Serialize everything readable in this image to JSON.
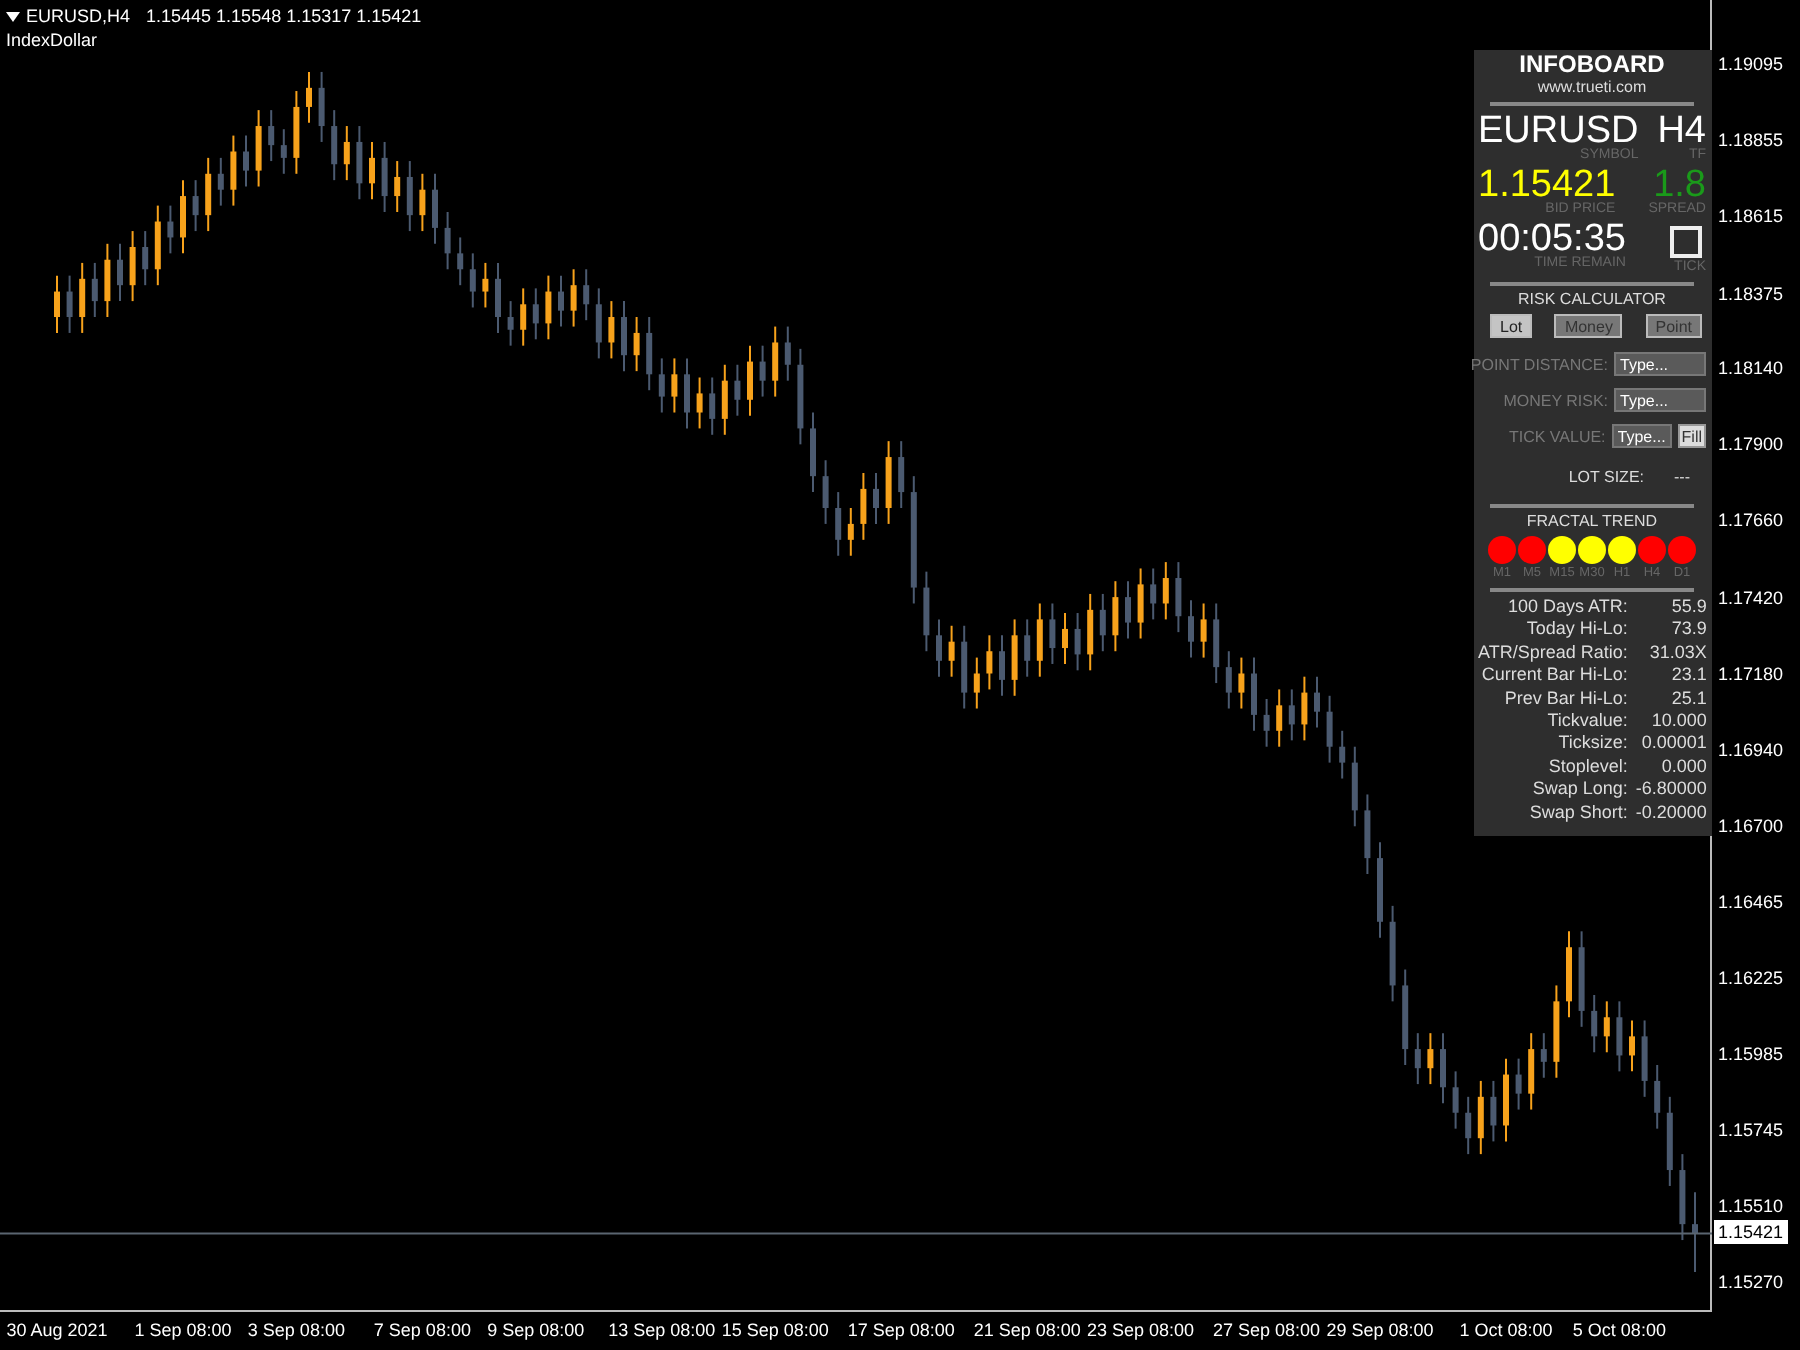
{
  "chart_header": {
    "symbol": "EURUSD,H4",
    "ohlc": "1.15445 1.15548 1.15317 1.15421",
    "indicator": "IndexDollar"
  },
  "chart_data": {
    "type": "candlestick",
    "ylim": [
      1.15174,
      1.19296
    ],
    "ref_lines": [
      {
        "axis": "y",
        "value": 1.15421,
        "label": "1.15421"
      }
    ],
    "yticks": [
      {
        "value": 1.19095,
        "label": "1.19095"
      },
      {
        "value": 1.18855,
        "label": "1.18855"
      },
      {
        "value": 1.18615,
        "label": "1.18615"
      },
      {
        "value": 1.18375,
        "label": "1.18375"
      },
      {
        "value": 1.1814,
        "label": "1.18140"
      },
      {
        "value": 1.179,
        "label": "1.17900"
      },
      {
        "value": 1.1766,
        "label": "1.17660"
      },
      {
        "value": 1.1742,
        "label": "1.17420"
      },
      {
        "value": 1.1718,
        "label": "1.17180"
      },
      {
        "value": 1.1694,
        "label": "1.16940"
      },
      {
        "value": 1.167,
        "label": "1.16700"
      },
      {
        "value": 1.16465,
        "label": "1.16465"
      },
      {
        "value": 1.16225,
        "label": "1.16225"
      },
      {
        "value": 1.15985,
        "label": "1.15985"
      },
      {
        "value": 1.15745,
        "label": "1.15745"
      },
      {
        "value": 1.1551,
        "label": "1.15510"
      },
      {
        "value": 1.1527,
        "label": "1.15270"
      }
    ],
    "categories": [
      "30 Aug 2021",
      null,
      null,
      null,
      null,
      null,
      null,
      null,
      null,
      null,
      "1 Sep 08:00",
      null,
      null,
      null,
      null,
      null,
      null,
      null,
      null,
      "3 Sep 08:00",
      null,
      null,
      null,
      null,
      null,
      null,
      null,
      null,
      null,
      "7 Sep 08:00",
      null,
      null,
      null,
      null,
      null,
      null,
      null,
      null,
      "9 Sep 08:00",
      null,
      null,
      null,
      null,
      null,
      null,
      null,
      null,
      null,
      "13 Sep 08:00",
      null,
      null,
      null,
      null,
      null,
      null,
      null,
      null,
      "15 Sep 08:00",
      null,
      null,
      null,
      null,
      null,
      null,
      null,
      null,
      null,
      "17 Sep 08:00",
      null,
      null,
      null,
      null,
      null,
      null,
      null,
      null,
      null,
      "21 Sep 08:00",
      null,
      null,
      null,
      null,
      null,
      null,
      null,
      null,
      "23 Sep 08:00",
      null,
      null,
      null,
      null,
      null,
      null,
      null,
      null,
      null,
      "27 Sep 08:00",
      null,
      null,
      null,
      null,
      null,
      null,
      null,
      null,
      "29 Sep 08:00",
      null,
      null,
      null,
      null,
      null,
      null,
      null,
      null,
      null,
      "1 Oct 08:00",
      null,
      null,
      null,
      null,
      null,
      null,
      null,
      null,
      "5 Oct 08:00",
      null,
      null,
      null,
      null,
      null,
      null
    ],
    "ohlc": [
      [
        1.183,
        1.1843,
        1.1825,
        1.1838
      ],
      [
        1.1838,
        1.1843,
        1.1825,
        1.183
      ],
      [
        1.183,
        1.1847,
        1.1825,
        1.1842
      ],
      [
        1.1842,
        1.1847,
        1.183,
        1.1835
      ],
      [
        1.1835,
        1.1853,
        1.183,
        1.1848
      ],
      [
        1.1848,
        1.1853,
        1.1835,
        1.184
      ],
      [
        1.184,
        1.1857,
        1.1835,
        1.1852
      ],
      [
        1.1852,
        1.1857,
        1.184,
        1.1845
      ],
      [
        1.1845,
        1.1865,
        1.184,
        1.186
      ],
      [
        1.186,
        1.1865,
        1.185,
        1.1855
      ],
      [
        1.1855,
        1.1873,
        1.185,
        1.1868
      ],
      [
        1.1868,
        1.1873,
        1.1857,
        1.1862
      ],
      [
        1.1862,
        1.188,
        1.1857,
        1.1875
      ],
      [
        1.1875,
        1.188,
        1.1865,
        1.187
      ],
      [
        1.187,
        1.1887,
        1.1865,
        1.1882
      ],
      [
        1.1882,
        1.1887,
        1.1871,
        1.1876
      ],
      [
        1.1876,
        1.1895,
        1.1871,
        1.189
      ],
      [
        1.189,
        1.1895,
        1.1879,
        1.1884
      ],
      [
        1.1884,
        1.1889,
        1.1875,
        1.188
      ],
      [
        1.188,
        1.1901,
        1.1875,
        1.1896
      ],
      [
        1.1896,
        1.1907,
        1.1891,
        1.1902
      ],
      [
        1.1902,
        1.1907,
        1.1885,
        1.189
      ],
      [
        1.189,
        1.1895,
        1.1873,
        1.1878
      ],
      [
        1.1878,
        1.189,
        1.1873,
        1.1885
      ],
      [
        1.1885,
        1.189,
        1.1867,
        1.1872
      ],
      [
        1.1872,
        1.1885,
        1.1867,
        1.188
      ],
      [
        1.188,
        1.1885,
        1.1863,
        1.1868
      ],
      [
        1.1868,
        1.1879,
        1.1863,
        1.1874
      ],
      [
        1.1874,
        1.1879,
        1.1857,
        1.1862
      ],
      [
        1.1862,
        1.1875,
        1.1857,
        1.187
      ],
      [
        1.187,
        1.1875,
        1.1853,
        1.1858
      ],
      [
        1.1858,
        1.1863,
        1.1845,
        1.185
      ],
      [
        1.185,
        1.1855,
        1.184,
        1.1845
      ],
      [
        1.1845,
        1.185,
        1.1833,
        1.1838
      ],
      [
        1.1838,
        1.1847,
        1.1833,
        1.1842
      ],
      [
        1.1842,
        1.1847,
        1.1825,
        1.183
      ],
      [
        1.183,
        1.1835,
        1.1821,
        1.1826
      ],
      [
        1.1826,
        1.1839,
        1.1821,
        1.1834
      ],
      [
        1.1834,
        1.1839,
        1.1823,
        1.1828
      ],
      [
        1.1828,
        1.1843,
        1.1823,
        1.1838
      ],
      [
        1.1838,
        1.1843,
        1.1827,
        1.1832
      ],
      [
        1.1832,
        1.1845,
        1.1827,
        1.184
      ],
      [
        1.184,
        1.1845,
        1.1829,
        1.1834
      ],
      [
        1.1834,
        1.1839,
        1.1817,
        1.1822
      ],
      [
        1.1822,
        1.1835,
        1.1817,
        1.183
      ],
      [
        1.183,
        1.1835,
        1.1813,
        1.1818
      ],
      [
        1.1818,
        1.183,
        1.1813,
        1.1825
      ],
      [
        1.1825,
        1.183,
        1.1807,
        1.1812
      ],
      [
        1.1812,
        1.1817,
        1.18,
        1.1805
      ],
      [
        1.1805,
        1.1817,
        1.18,
        1.1812
      ],
      [
        1.1812,
        1.1817,
        1.1795,
        1.18
      ],
      [
        1.18,
        1.1811,
        1.1795,
        1.1806
      ],
      [
        1.1806,
        1.1811,
        1.1793,
        1.1798
      ],
      [
        1.1798,
        1.1815,
        1.1793,
        1.181
      ],
      [
        1.181,
        1.1815,
        1.1799,
        1.1804
      ],
      [
        1.1804,
        1.1821,
        1.1799,
        1.1816
      ],
      [
        1.1816,
        1.1821,
        1.1805,
        1.181
      ],
      [
        1.181,
        1.1827,
        1.1805,
        1.1822
      ],
      [
        1.1822,
        1.1827,
        1.181,
        1.1815
      ],
      [
        1.1815,
        1.182,
        1.179,
        1.1795
      ],
      [
        1.1795,
        1.18,
        1.1775,
        1.178
      ],
      [
        1.178,
        1.1785,
        1.1765,
        1.177
      ],
      [
        1.177,
        1.1775,
        1.1755,
        1.176
      ],
      [
        1.176,
        1.177,
        1.1755,
        1.1765
      ],
      [
        1.1765,
        1.1781,
        1.176,
        1.1776
      ],
      [
        1.1776,
        1.1781,
        1.1765,
        1.177
      ],
      [
        1.177,
        1.1791,
        1.1765,
        1.1786
      ],
      [
        1.1786,
        1.1791,
        1.177,
        1.1775
      ],
      [
        1.1775,
        1.178,
        1.174,
        1.1745
      ],
      [
        1.1745,
        1.175,
        1.1725,
        1.173
      ],
      [
        1.173,
        1.1735,
        1.1717,
        1.1722
      ],
      [
        1.1722,
        1.1733,
        1.1717,
        1.1728
      ],
      [
        1.1728,
        1.1733,
        1.1707,
        1.1712
      ],
      [
        1.1712,
        1.1723,
        1.1707,
        1.1718
      ],
      [
        1.1718,
        1.173,
        1.1713,
        1.1725
      ],
      [
        1.1725,
        1.173,
        1.1711,
        1.1716
      ],
      [
        1.1716,
        1.1735,
        1.1711,
        1.173
      ],
      [
        1.173,
        1.1735,
        1.1717,
        1.1722
      ],
      [
        1.1722,
        1.174,
        1.1717,
        1.1735
      ],
      [
        1.1735,
        1.174,
        1.1721,
        1.1726
      ],
      [
        1.1726,
        1.1737,
        1.1721,
        1.1732
      ],
      [
        1.1732,
        1.1737,
        1.1719,
        1.1724
      ],
      [
        1.1724,
        1.1743,
        1.1719,
        1.1738
      ],
      [
        1.1738,
        1.1743,
        1.1725,
        1.173
      ],
      [
        1.173,
        1.1747,
        1.1725,
        1.1742
      ],
      [
        1.1742,
        1.1747,
        1.1729,
        1.1734
      ],
      [
        1.1734,
        1.1751,
        1.1729,
        1.1746
      ],
      [
        1.1746,
        1.1751,
        1.1735,
        1.174
      ],
      [
        1.174,
        1.1753,
        1.1735,
        1.1748
      ],
      [
        1.1748,
        1.1753,
        1.1731,
        1.1736
      ],
      [
        1.1736,
        1.1741,
        1.1723,
        1.1728
      ],
      [
        1.1728,
        1.174,
        1.1723,
        1.1735
      ],
      [
        1.1735,
        1.174,
        1.1715,
        1.172
      ],
      [
        1.172,
        1.1725,
        1.1707,
        1.1712
      ],
      [
        1.1712,
        1.1723,
        1.1707,
        1.1718
      ],
      [
        1.1718,
        1.1723,
        1.17,
        1.1705
      ],
      [
        1.1705,
        1.171,
        1.1695,
        1.17
      ],
      [
        1.17,
        1.1713,
        1.1695,
        1.1708
      ],
      [
        1.1708,
        1.1713,
        1.1697,
        1.1702
      ],
      [
        1.1702,
        1.1717,
        1.1697,
        1.1712
      ],
      [
        1.1712,
        1.1717,
        1.1701,
        1.1706
      ],
      [
        1.1706,
        1.1711,
        1.169,
        1.1695
      ],
      [
        1.1695,
        1.17,
        1.1685,
        1.169
      ],
      [
        1.169,
        1.1695,
        1.167,
        1.1675
      ],
      [
        1.1675,
        1.168,
        1.1655,
        1.166
      ],
      [
        1.166,
        1.1665,
        1.1635,
        1.164
      ],
      [
        1.164,
        1.1645,
        1.1615,
        1.162
      ],
      [
        1.162,
        1.1625,
        1.1595,
        1.16
      ],
      [
        1.16,
        1.1605,
        1.1589,
        1.1594
      ],
      [
        1.1594,
        1.1605,
        1.1589,
        1.16
      ],
      [
        1.16,
        1.1605,
        1.1583,
        1.1588
      ],
      [
        1.1588,
        1.1593,
        1.1575,
        1.158
      ],
      [
        1.158,
        1.1585,
        1.1567,
        1.1572
      ],
      [
        1.1572,
        1.159,
        1.1567,
        1.1585
      ],
      [
        1.1585,
        1.159,
        1.1571,
        1.1576
      ],
      [
        1.1576,
        1.1597,
        1.1571,
        1.1592
      ],
      [
        1.1592,
        1.1597,
        1.1581,
        1.1586
      ],
      [
        1.1586,
        1.1605,
        1.1581,
        1.16
      ],
      [
        1.16,
        1.1605,
        1.1591,
        1.1596
      ],
      [
        1.1596,
        1.162,
        1.1591,
        1.1615
      ],
      [
        1.1615,
        1.1637,
        1.161,
        1.1632
      ],
      [
        1.1632,
        1.1637,
        1.1607,
        1.1612
      ],
      [
        1.1612,
        1.1617,
        1.1599,
        1.1604
      ],
      [
        1.1604,
        1.1615,
        1.1599,
        1.161
      ],
      [
        1.161,
        1.1615,
        1.1593,
        1.1598
      ],
      [
        1.1598,
        1.1609,
        1.1593,
        1.1604
      ],
      [
        1.1604,
        1.1609,
        1.1585,
        1.159
      ],
      [
        1.159,
        1.1595,
        1.1575,
        1.158
      ],
      [
        1.158,
        1.1585,
        1.1557,
        1.1562
      ],
      [
        1.1562,
        1.1567,
        1.154,
        1.1545
      ],
      [
        1.1545,
        1.1555,
        1.153,
        1.1542
      ]
    ]
  },
  "infoboard": {
    "title": "INFOBOARD",
    "website": "www.trueti.com",
    "symbol": {
      "value": "EURUSD",
      "caption": "SYMBOL"
    },
    "timeframe": {
      "value": "H4",
      "caption": "TF"
    },
    "bid": {
      "value": "1.15421",
      "caption": "BID PRICE"
    },
    "spread": {
      "value": "1.8",
      "caption": "SPREAD"
    },
    "time_remain": {
      "value": "00:05:35",
      "caption": "TIME REMAIN"
    },
    "tick": {
      "caption": "TICK",
      "checked": false
    },
    "risk_title": "RISK CALCULATOR",
    "modes": [
      {
        "label": "Lot",
        "selected": true
      },
      {
        "label": "Money",
        "selected": false
      },
      {
        "label": "Point",
        "selected": false
      }
    ],
    "fields": [
      {
        "label": "POINT DISTANCE:",
        "placeholder": "Type..."
      },
      {
        "label": "MONEY RISK:",
        "placeholder": "Type..."
      },
      {
        "label": "TICK VALUE:",
        "placeholder": "Type...",
        "button": "Fill"
      }
    ],
    "lot_size": {
      "label": "LOT SIZE:",
      "value": "---"
    },
    "fractal_title": "FRACTAL TREND",
    "fractals": [
      {
        "label": "M1",
        "color": "#ff0000"
      },
      {
        "label": "M5",
        "color": "#ff0000"
      },
      {
        "label": "M15",
        "color": "#ffff00"
      },
      {
        "label": "M30",
        "color": "#ffff00"
      },
      {
        "label": "H1",
        "color": "#ffff00"
      },
      {
        "label": "H4",
        "color": "#ff0000"
      },
      {
        "label": "D1",
        "color": "#ff0000"
      }
    ],
    "stats": [
      {
        "label": "100 Days ATR:",
        "value": "55.9"
      },
      {
        "label": "Today Hi-Lo:",
        "value": "73.9"
      },
      {
        "label": "ATR/Spread Ratio:",
        "value": "31.03X"
      },
      {
        "label": "Current Bar Hi-Lo:",
        "value": "23.1"
      },
      {
        "label": "Prev Bar Hi-Lo:",
        "value": "25.1"
      },
      {
        "label": "Tickvalue:",
        "value": "10.000"
      },
      {
        "label": "Ticksize:",
        "value": "0.00001"
      },
      {
        "label": "Stoplevel:",
        "value": "0.000"
      },
      {
        "label": "Swap Long:",
        "value": "-6.80000"
      },
      {
        "label": "Swap Short:",
        "value": "-0.20000"
      }
    ]
  }
}
